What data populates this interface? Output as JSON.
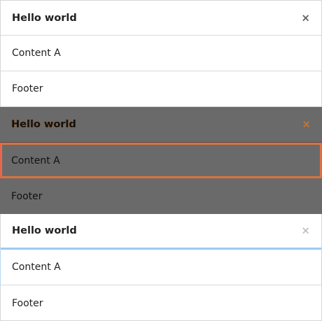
{
  "panels": [
    {
      "state": "default",
      "title": "Hello world",
      "close_icon": "close-icon",
      "content": "Content A",
      "footer": "Footer"
    },
    {
      "state": "overlay",
      "title": "Hello world",
      "close_icon": "close-icon",
      "content": "Content A",
      "footer": "Footer"
    },
    {
      "state": "focused",
      "title": "Hello world",
      "close_icon": "close-icon",
      "content": "Content A",
      "footer": "Footer"
    }
  ],
  "close_glyph": "×",
  "colors": {
    "overlay_background": "#6a6a6a",
    "overlay_accent": "#e8664a",
    "focus_accent": "#9ccaf3"
  }
}
